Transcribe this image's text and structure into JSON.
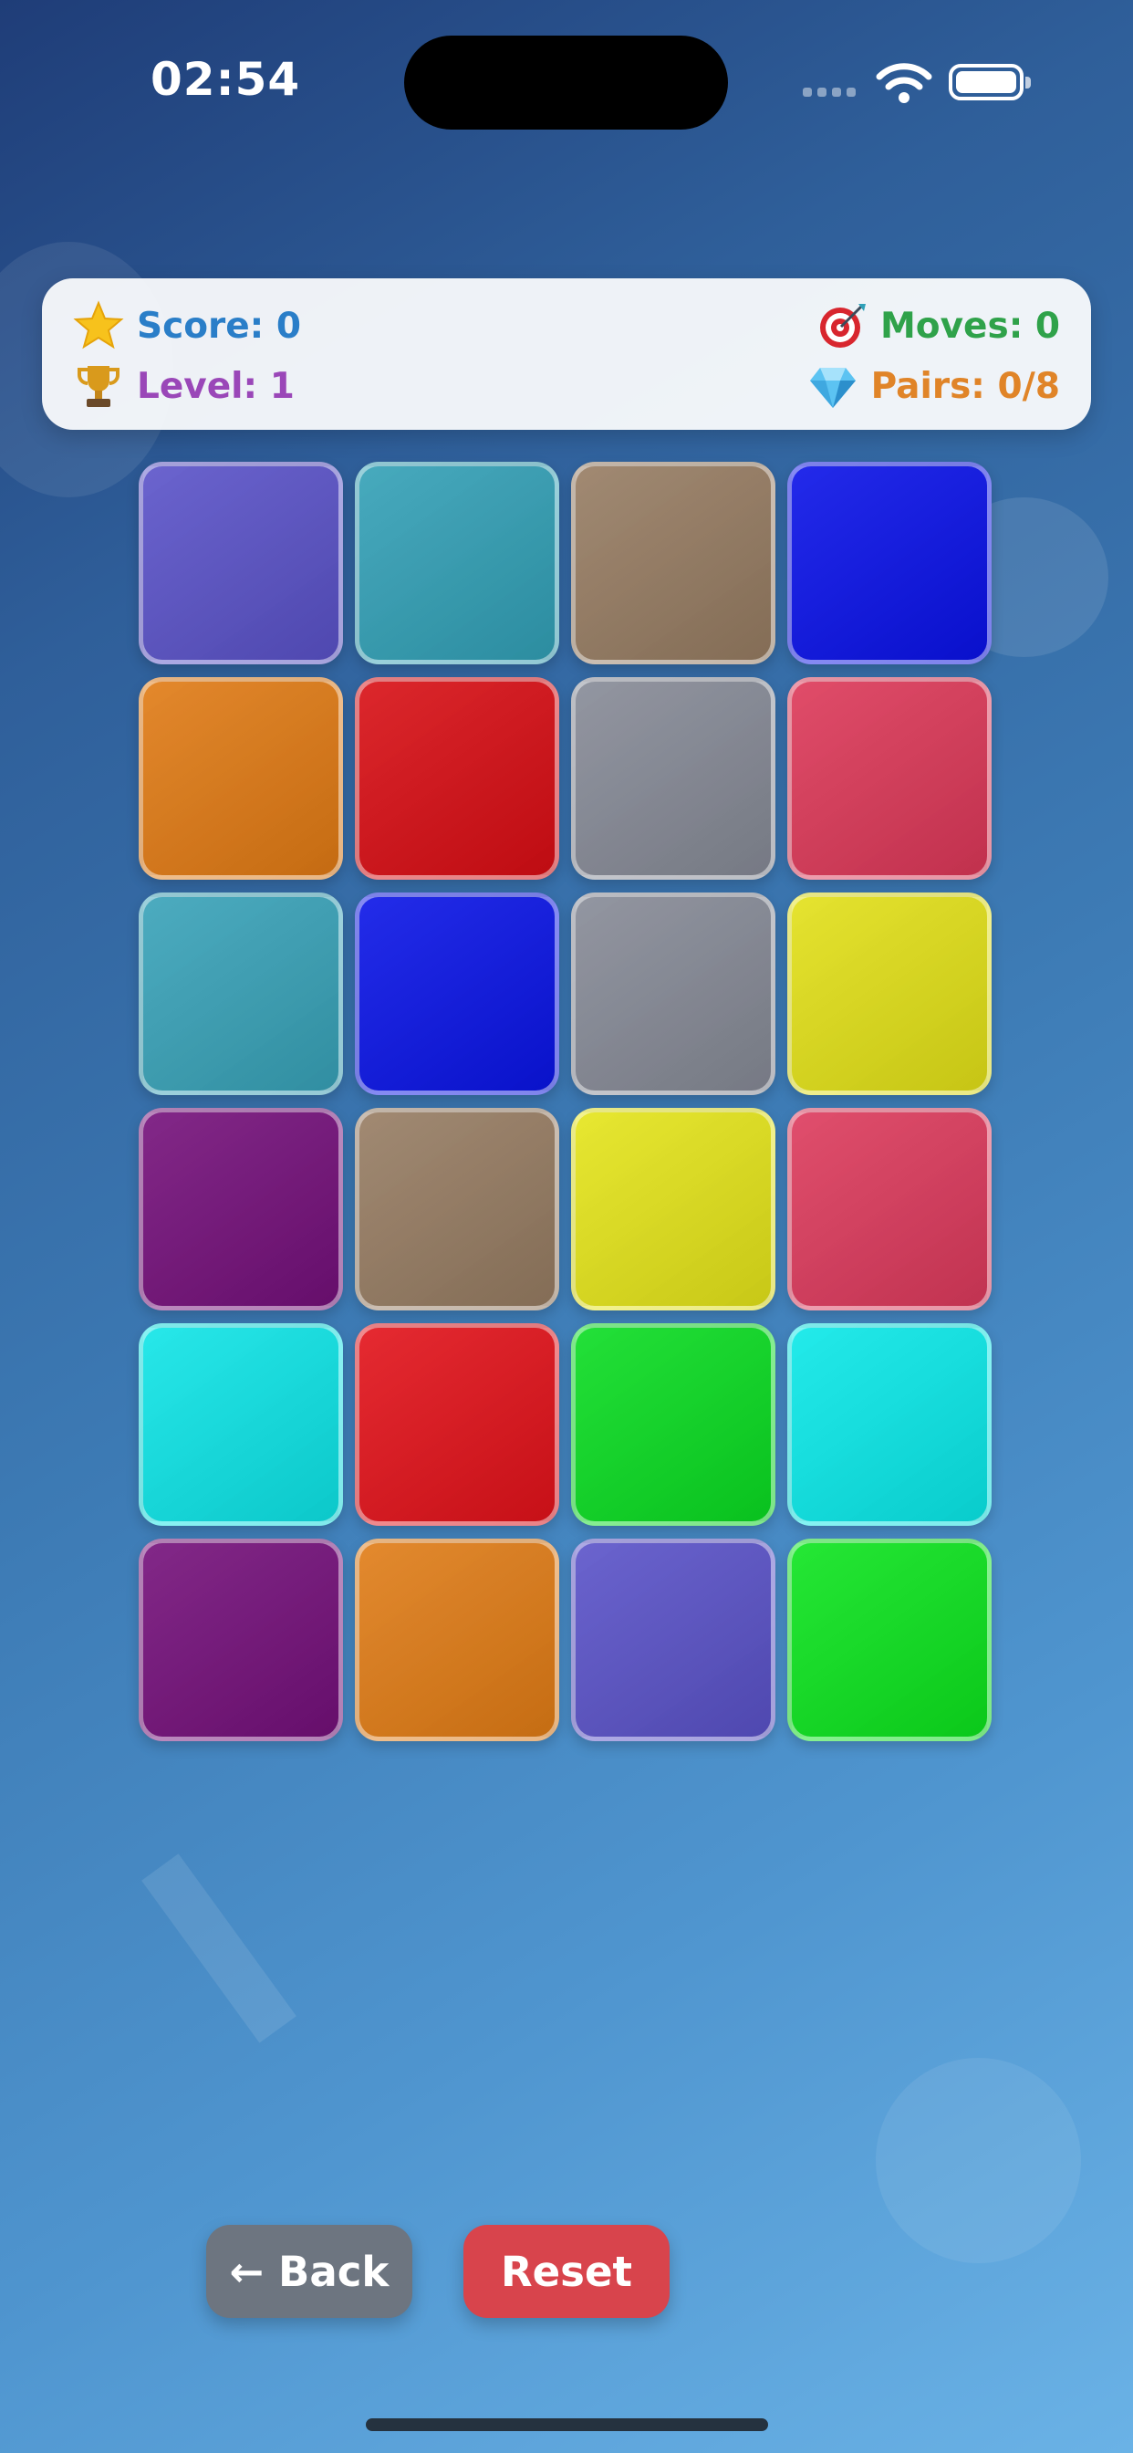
{
  "status_bar": {
    "time": "02:54"
  },
  "stats": {
    "score": {
      "icon": "star-icon",
      "label": "Score: 0"
    },
    "level": {
      "icon": "trophy-icon",
      "label": "Level: 1"
    },
    "moves": {
      "icon": "target-icon",
      "label": "Moves: 0"
    },
    "pairs": {
      "icon": "diamond-icon",
      "label": "Pairs: 0/8"
    }
  },
  "board": {
    "rows": 6,
    "cols": 4,
    "tile_colors": [
      [
        "#5a52c8",
        "#32a0b6",
        "#967c62",
        "#0a12e8"
      ],
      [
        "#e07a14",
        "#d80e14",
        "#868a96",
        "#dc3858"
      ],
      [
        "#38a2b8",
        "#0a14e6",
        "#868a96",
        "#e2e018"
      ],
      [
        "#74107a",
        "#967c62",
        "#e4e41a",
        "#dc3a5c"
      ],
      [
        "#0ee4e6",
        "#e2121a",
        "#0adc22",
        "#0ae8e8"
      ],
      [
        "#74107a",
        "#e07c16",
        "#5a52c8",
        "#0ce41e"
      ]
    ]
  },
  "buttons": {
    "back_label": "← Back",
    "reset_label": "Reset"
  }
}
